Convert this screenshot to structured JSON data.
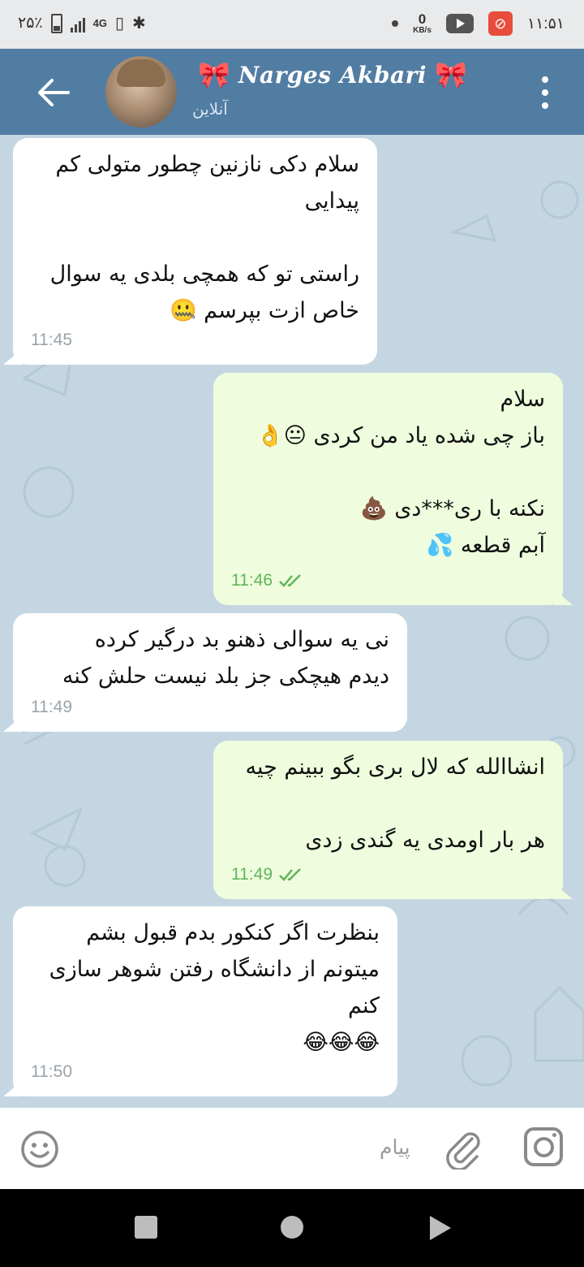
{
  "status_bar": {
    "battery": "۲۵٪",
    "network": "4G",
    "speed_value": "0",
    "speed_unit": "KB/s",
    "clock": "۱۱:۵۱"
  },
  "header": {
    "contact_name": "Narges Akbari",
    "decor": "🎀",
    "status": "آنلاین"
  },
  "messages": [
    {
      "dir": "in",
      "lines": [
        "سلام دکی نازنین چطور متولی کم",
        "پیدایی",
        "",
        "راستی تو که همچی بلدی یه سوال",
        "خاص ازت بپرسم 🤐"
      ],
      "time": "11:45"
    },
    {
      "dir": "out",
      "lines": [
        "سلام",
        "باز چی شده یاد من کردی 😐👌",
        "",
        "نکنه با ری***دی 💩",
        "آبم قطعه 💦"
      ],
      "time": "11:46"
    },
    {
      "dir": "in",
      "lines": [
        "نی یه سوالی ذهنو بد درگیر کرده",
        "دیدم هیچکی جز بلد نیست حلش کنه"
      ],
      "time": "11:49"
    },
    {
      "dir": "out",
      "lines": [
        "انشاالله که لال بری بگو ببینم چیه",
        "",
        "هر بار اومدی یه گندی زدی"
      ],
      "time": "11:49"
    },
    {
      "dir": "in",
      "lines": [
        "بنظرت اگر کنکور بدم قبول بشم",
        "میتونم از دانشگاه رفتن شوهر سازی",
        "کنم",
        "😂😂😂"
      ],
      "time": "11:50"
    }
  ],
  "input": {
    "placeholder": "پیام"
  },
  "icons": {
    "back": "back-arrow-icon",
    "menu": "more-vertical-icon",
    "emoji": "smiley-icon",
    "attach": "paperclip-icon",
    "camera": "instagram-camera-icon",
    "read_receipt": "double-check-icon"
  },
  "colors": {
    "header": "#527da3",
    "chat_bg": "#c4d6e1",
    "incoming": "#ffffff",
    "outgoing": "#effdde",
    "outgoing_time": "#5fb55a"
  }
}
